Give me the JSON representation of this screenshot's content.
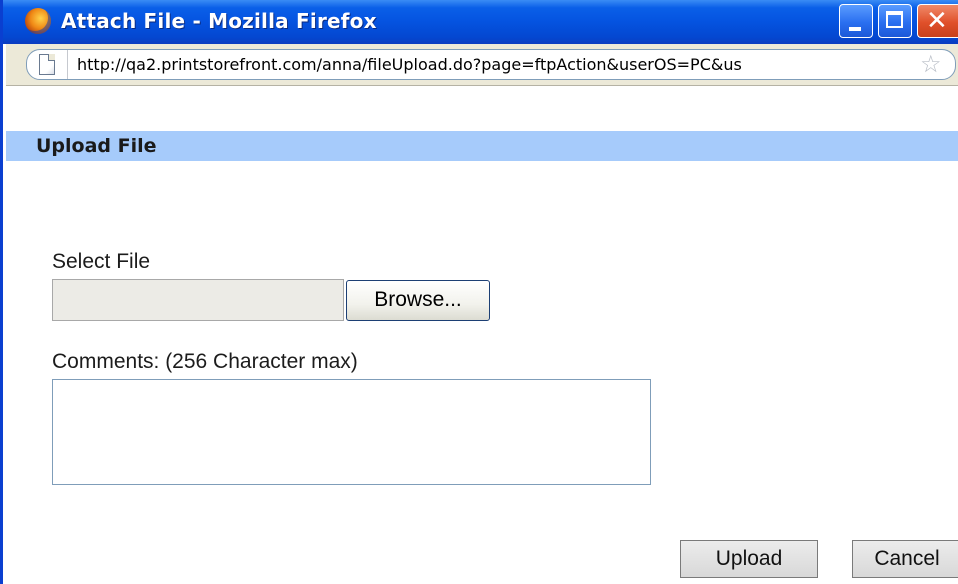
{
  "window": {
    "title": "Attach File - Mozilla Firefox",
    "controls": {
      "minimize": "minimize-icon",
      "maximize": "maximize-icon",
      "close": "close-icon",
      "close_glyph": "✕"
    }
  },
  "addressbar": {
    "url": "http://qa2.printstorefront.com/anna/fileUpload.do?page=ftpAction&userOS=PC&us",
    "page_icon": "page-icon",
    "bookmark_icon": "star-icon",
    "bookmark_glyph": "☆"
  },
  "form": {
    "section_title": "Upload File",
    "select_file_label": "Select File",
    "file_value": "",
    "browse_label": "Browse...",
    "comments_label": "Comments: (256 Character max)",
    "comments_value": "",
    "upload_label": "Upload",
    "cancel_label": "Cancel"
  },
  "colors": {
    "titlebar": "#0553e0",
    "section_header": "#a6cbfb",
    "chrome": "#ece9d8"
  }
}
